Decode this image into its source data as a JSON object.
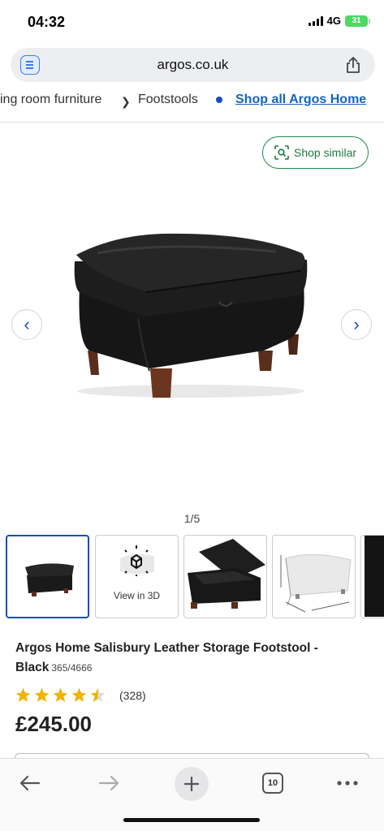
{
  "status_bar": {
    "time": "04:32",
    "network": "4G",
    "battery": "31"
  },
  "browser": {
    "url": "argos.co.uk",
    "tabs_count": "10"
  },
  "breadcrumb": {
    "items": [
      "ing room furniture",
      "Footstools"
    ],
    "link": "Shop all Argos Home"
  },
  "gallery": {
    "shop_similar_label": "Shop similar",
    "counter": "1/5",
    "view_3d_label": "View in 3D"
  },
  "product": {
    "title": "Argos Home Salisbury Leather Storage Footstool - Black",
    "sku": "365/4666",
    "rating": 4.5,
    "review_count": "(328)",
    "price": "£245.00"
  },
  "colors": {
    "accent": "#1a4fb4",
    "link": "#1565c0",
    "green": "#1c8a4c",
    "star": "#f0b400"
  }
}
